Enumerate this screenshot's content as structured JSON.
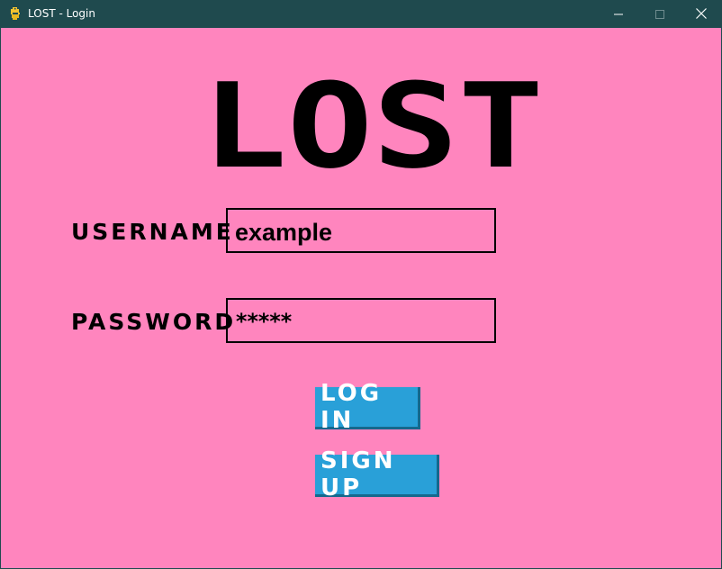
{
  "window": {
    "title": "LOST - Login",
    "app_icon": "python-snake-icon",
    "controls": [
      "minimize-icon",
      "maximize-icon",
      "close-icon"
    ]
  },
  "game": {
    "logo_text": "LOST"
  },
  "form": {
    "username_label": "USERNAME",
    "username_value": "example",
    "password_label": "PASSWORD",
    "password_mask": "*****"
  },
  "buttons": {
    "login_label": "LOG IN",
    "signup_label": "SIGN UP"
  },
  "colors": {
    "titlebar": "#1f4a4e",
    "background": "#ff85be",
    "button": "#29a0d8",
    "button_shadow": "#15688d",
    "text": "#000000"
  }
}
